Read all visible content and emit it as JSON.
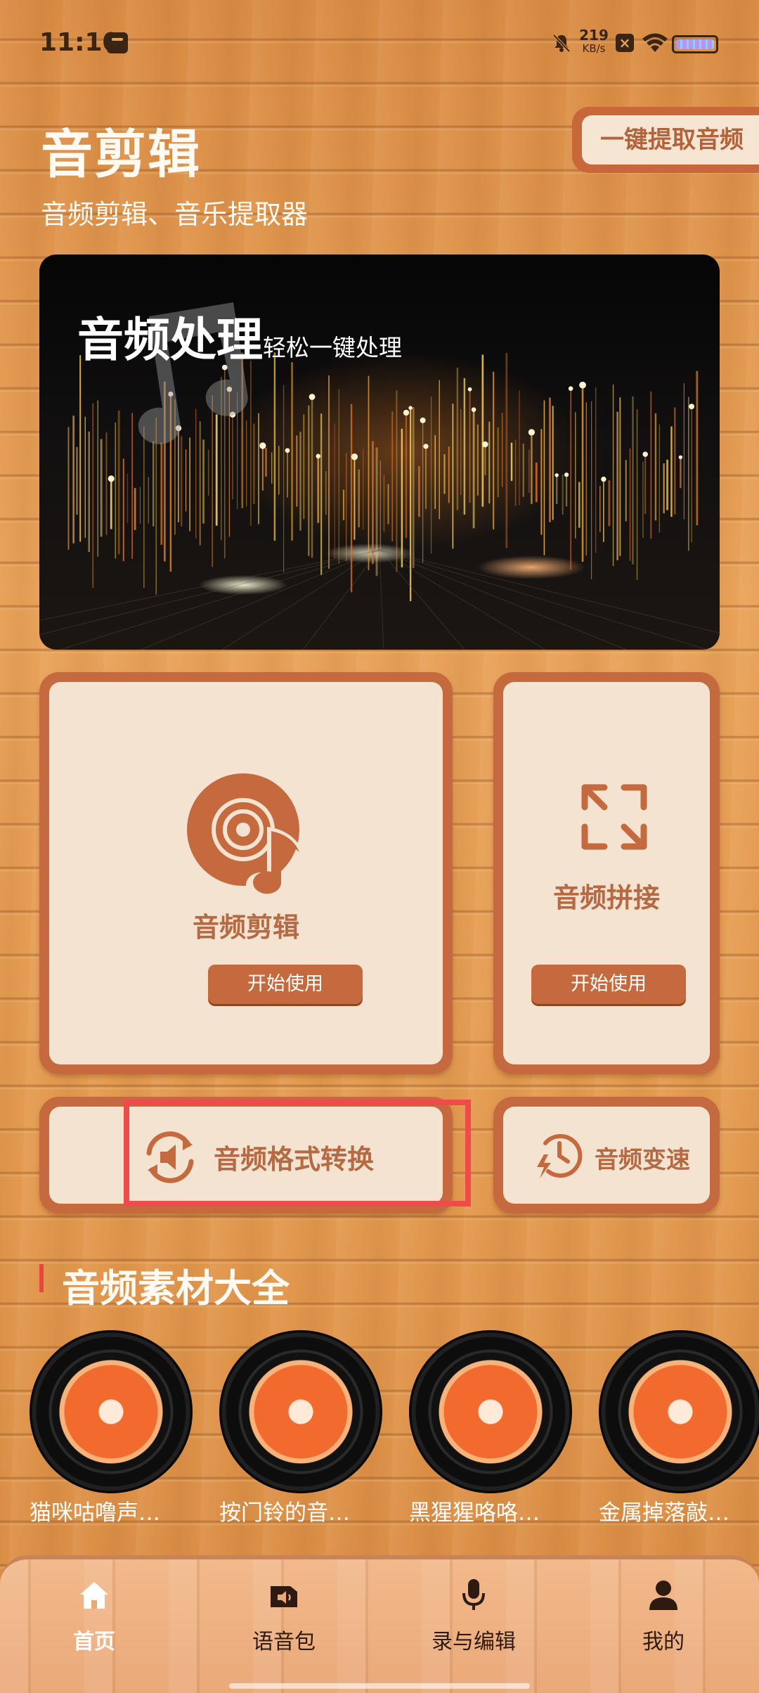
{
  "status_bar": {
    "time": "11:10",
    "net_speed_value": "219",
    "net_speed_unit": "KB/s"
  },
  "header": {
    "title": "音剪辑",
    "subtitle": "音频剪辑、音乐提取器",
    "extract_button": "一键提取音频"
  },
  "banner": {
    "title": "音频处理",
    "subtitle": "轻松一键处理"
  },
  "features": {
    "edit": {
      "label": "音频剪辑",
      "button": "开始使用"
    },
    "join": {
      "label": "音频拼接",
      "button": "开始使用"
    },
    "convert": {
      "label": "音频格式转换"
    },
    "speed": {
      "label": "音频变速"
    }
  },
  "section": {
    "title": "音频素材大全",
    "items": [
      {
        "label": "猫咪咕噜声…"
      },
      {
        "label": "按门铃的音…"
      },
      {
        "label": "黑猩猩咯咯…"
      },
      {
        "label": "金属掉落敲…"
      }
    ]
  },
  "nav": {
    "items": [
      {
        "label": "首页",
        "icon": "home-icon",
        "active": true
      },
      {
        "label": "语音包",
        "icon": "voice-pack-icon",
        "active": false
      },
      {
        "label": "录与编辑",
        "icon": "microphone-icon",
        "active": false
      },
      {
        "label": "我的",
        "icon": "profile-icon",
        "active": false
      }
    ]
  },
  "colors": {
    "accent": "#c46a3e",
    "card_bg": "#f3e3d0",
    "label": "#b56a44",
    "highlight": "#ef4b4b",
    "section_bar": "#e8473d"
  }
}
